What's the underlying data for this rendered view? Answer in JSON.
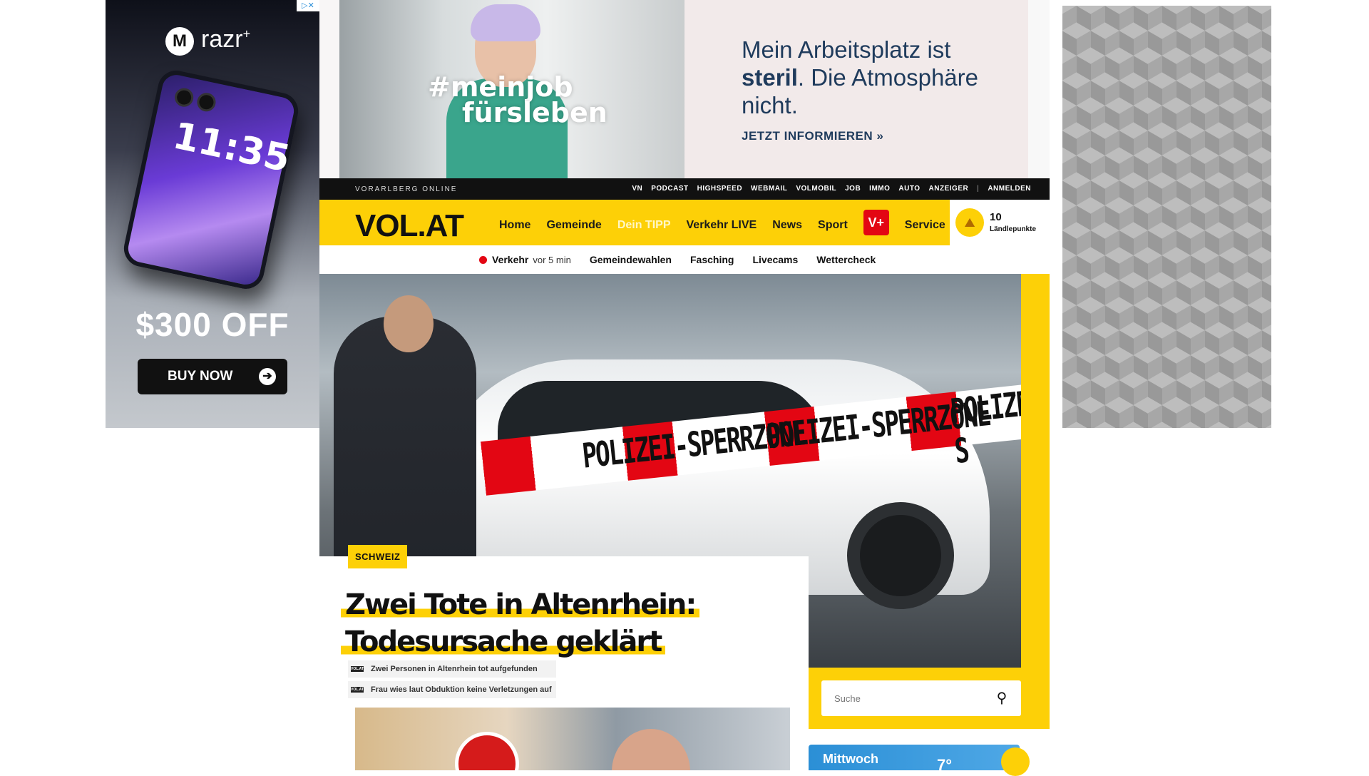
{
  "ad_left": {
    "adchoices": "▷✕",
    "brand_logo": "M",
    "brand": "razr",
    "brand_plus": "+",
    "phone_time": "11:35",
    "offer": "$300 OFF",
    "button": "BUY NOW",
    "button_arrow": "➔"
  },
  "ad_top": {
    "hashtag_line1": "#meinjob",
    "hashtag_line2": "fürsleben",
    "headline_pre": "Mein Arbeitsplatz ist ",
    "headline_bold": "steril",
    "headline_post": ". Die Atmosphäre nicht.",
    "cta": "JETZT INFORMIEREN »"
  },
  "topbar": {
    "site_label": "VORARLBERG ONLINE",
    "links": [
      "VN",
      "PODCAST",
      "HIGHSPEED",
      "WEBMAIL",
      "VOLMOBIL",
      "JOB",
      "IMMO",
      "AUTO",
      "ANZEIGER"
    ],
    "separator": "|",
    "login": "ANMELDEN"
  },
  "mainnav": {
    "logo": "VOL.AT",
    "items": [
      "Home",
      "Gemeinde",
      "Dein TIPP",
      "Verkehr LIVE",
      "News",
      "Sport"
    ],
    "vplus": "V+",
    "service": "Service",
    "points_value": "10",
    "points_label": "Ländlepunkte"
  },
  "subnav": {
    "verkehr": "Verkehr",
    "verkehr_age": "vor 5 min",
    "items": [
      "Gemeindewahlen",
      "Fasching",
      "Livecams",
      "Wettercheck"
    ]
  },
  "hero": {
    "tape_text": [
      "POLIZEI-SPERRZONE",
      "POLIZEI-SPERRZONE",
      "POLIZEI-S"
    ]
  },
  "article": {
    "category": "SCHWEIZ",
    "title_line1": "Zwei Tote in Altenrhein:",
    "title_line2": "Todesursache geklärt",
    "bullet_badge": "VOL.AT",
    "bullets": [
      "Zwei Personen in Altenrhein tot aufgefunden",
      "Frau wies laut Obduktion keine Verletzungen auf"
    ]
  },
  "search": {
    "placeholder": "Suche",
    "icon": "⚲"
  },
  "weather": {
    "day": "Mittwoch",
    "temp": "7°"
  },
  "colors": {
    "brand_yellow": "#fdd007",
    "vplus_red": "#e30613",
    "ad_navy": "#1f3b5c"
  }
}
